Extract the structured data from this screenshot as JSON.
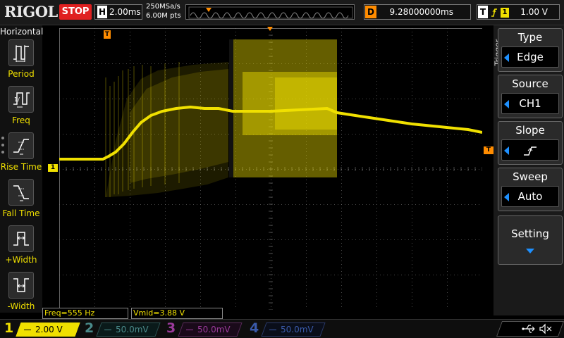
{
  "topbar": {
    "brand": "RIGOL",
    "run_state": "STOP",
    "timebase_key": "H",
    "timebase_value": "2.00ms",
    "sample_rate": "250MSa/s",
    "memory_depth": "6.00M pts",
    "delay_key": "D",
    "delay_value": "9.28000000ms",
    "trigger_key": "T",
    "trigger_source_number": "1",
    "trigger_level": "1.00 V"
  },
  "left_menu": {
    "title": "Horizontal",
    "items": [
      {
        "label": "Period",
        "icon": "period-icon"
      },
      {
        "label": "Freq",
        "icon": "frequency-icon"
      },
      {
        "label": "Rise Time",
        "icon": "rise-time-icon"
      },
      {
        "label": "Fall Time",
        "icon": "fall-time-icon"
      },
      {
        "label": "+Width",
        "icon": "positive-width-icon"
      },
      {
        "label": "-Width",
        "icon": "negative-width-icon"
      }
    ]
  },
  "markers": {
    "trigger_position": "T",
    "ch1_ground": "1",
    "trigger_level": "T"
  },
  "measurements": [
    {
      "text": "Freq=555 Hz"
    },
    {
      "text": "Vmid=3.88 V"
    }
  ],
  "right_menu": {
    "tab_label": "Trigger",
    "items": [
      {
        "title": "Type",
        "value": "Edge"
      },
      {
        "title": "Source",
        "value": "CH1"
      },
      {
        "title": "Slope",
        "value": "",
        "icon": "rising-edge-icon"
      },
      {
        "title": "Sweep",
        "value": "Auto"
      }
    ],
    "setting_label": "Setting"
  },
  "channels": [
    {
      "number": "1",
      "scale": "2.00 V",
      "active": true,
      "color": "#f0e000"
    },
    {
      "number": "2",
      "scale": "50.0mV",
      "active": false,
      "color": "#4a8a8a"
    },
    {
      "number": "3",
      "scale": "50.0mV",
      "active": false,
      "color": "#9a3a9a"
    },
    {
      "number": "4",
      "scale": "50.0mV",
      "active": false,
      "color": "#3a5aaa"
    }
  ],
  "status_icons": [
    "usb-icon",
    "speaker-muted-icon"
  ],
  "colors": {
    "ch1": "#f0e000",
    "trigger": "#ff8c00",
    "stop": "#e02020",
    "accent": "#1e90ff"
  }
}
